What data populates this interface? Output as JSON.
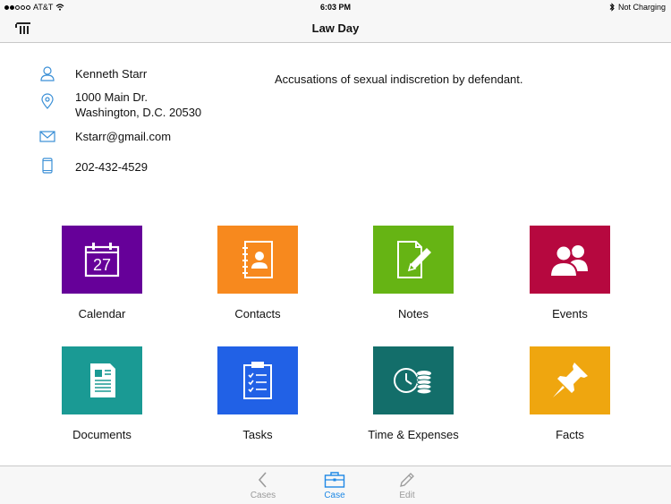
{
  "status_bar": {
    "carrier": "AT&T",
    "time": "6:03 PM",
    "battery_status": "Not Charging"
  },
  "nav": {
    "title": "Law Day"
  },
  "contact": {
    "name": "Kenneth Starr",
    "address_line1": "1000 Main Dr.",
    "address_line2": "Washington, D.C. 20530",
    "email": "Kstarr@gmail.com",
    "phone": "202-432-4529"
  },
  "case": {
    "description": "Accusations of sexual indiscretion by defendant."
  },
  "tiles": [
    {
      "label": "Calendar",
      "color": "#660099",
      "icon": "calendar-icon",
      "day": "27"
    },
    {
      "label": "Contacts",
      "color": "#f7891e",
      "icon": "address-book-icon"
    },
    {
      "label": "Notes",
      "color": "#66b414",
      "icon": "note-pencil-icon"
    },
    {
      "label": "Events",
      "color": "#b6083f",
      "icon": "people-icon"
    },
    {
      "label": "Documents",
      "color": "#1a9a94",
      "icon": "document-icon"
    },
    {
      "label": "Tasks",
      "color": "#2161e6",
      "icon": "clipboard-icon"
    },
    {
      "label": "Time & Expenses",
      "color": "#136e6a",
      "icon": "clock-coins-icon"
    },
    {
      "label": "Facts",
      "color": "#efa60f",
      "icon": "pushpin-icon"
    }
  ],
  "tab_bar": {
    "tabs": [
      {
        "label": "Cases",
        "icon": "chevron-left-icon"
      },
      {
        "label": "Case",
        "icon": "briefcase-icon",
        "active": true
      },
      {
        "label": "Edit",
        "icon": "pencil-icon"
      }
    ]
  },
  "colors": {
    "accent": "#1e88e5",
    "icon_outline": "#3a8fd6"
  }
}
